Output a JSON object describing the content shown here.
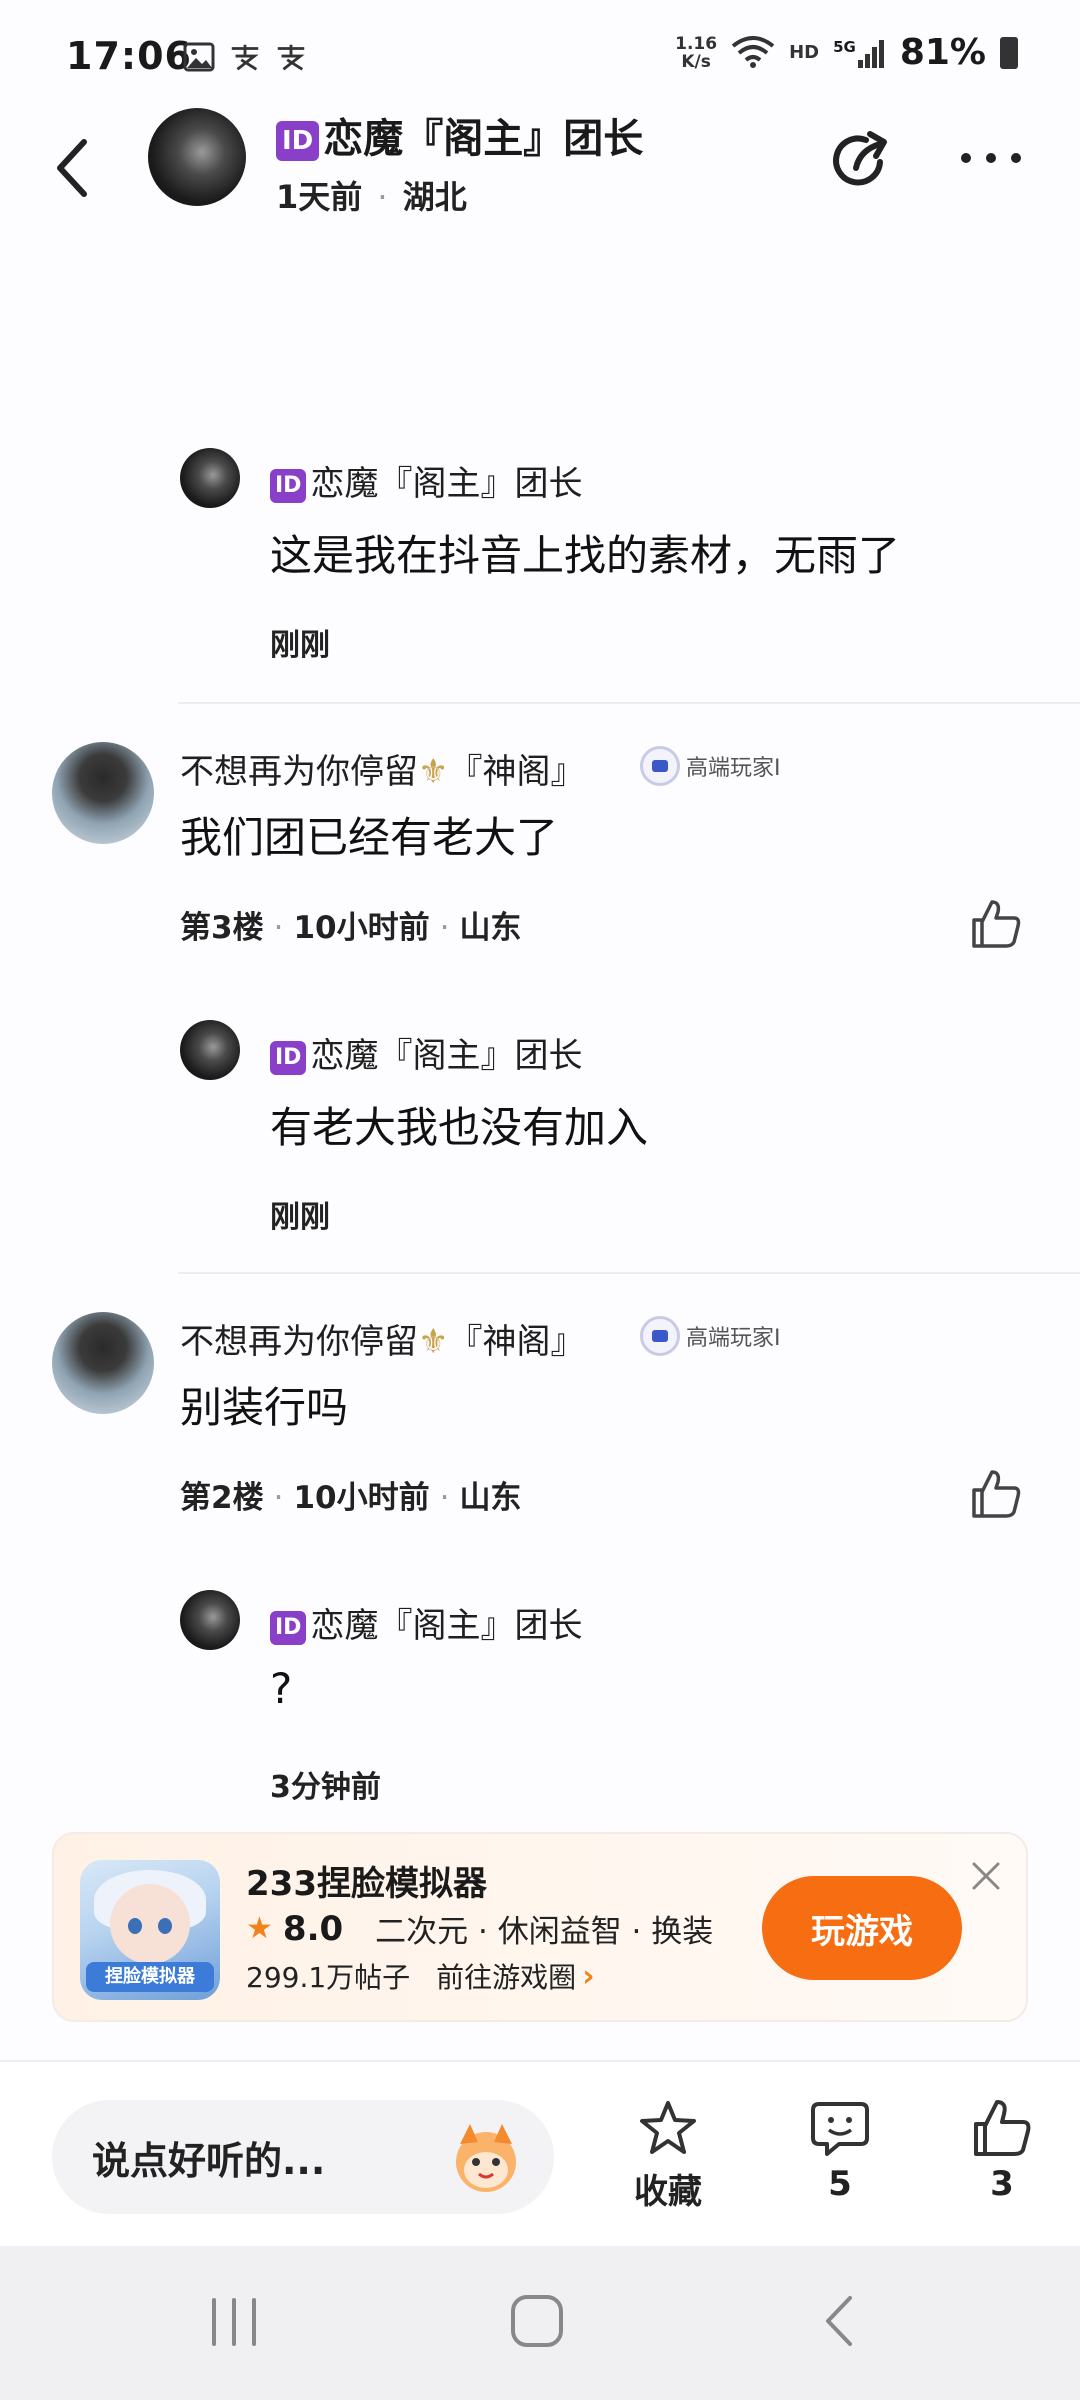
{
  "status_bar": {
    "time": "17:06",
    "net_speed_value": "1.16",
    "net_speed_unit": "K/s",
    "hd": "HD",
    "network": "5G",
    "battery": "81%"
  },
  "header": {
    "badge": "ID",
    "author_name": "恋魔『阁主』团长",
    "meta_time": "1天前",
    "meta_sep": "·",
    "meta_location": "湖北"
  },
  "thread": [
    {
      "type": "reply",
      "badge": "ID",
      "name": "恋魔『阁主』团长",
      "text": "这是我在抖音上找的素材，无雨了",
      "time": "刚刚"
    },
    {
      "type": "comment",
      "name_prefix": "不想再为你停留",
      "name_suffix": "『神阁』",
      "level": "高端玩家I",
      "text": "我们团已经有老大了",
      "floor": "第3楼",
      "time": "10小时前",
      "location": "山东"
    },
    {
      "type": "reply",
      "badge": "ID",
      "name": "恋魔『阁主』团长",
      "text": "有老大我也没有加入",
      "time": "刚刚"
    },
    {
      "type": "comment",
      "name_prefix": "不想再为你停留",
      "name_suffix": "『神阁』",
      "level": "高端玩家I",
      "text": "别装行吗",
      "floor": "第2楼",
      "time": "10小时前",
      "location": "山东"
    },
    {
      "type": "reply",
      "badge": "ID",
      "name": "恋魔『阁主』团长",
      "text": "?",
      "time": "3分钟前"
    }
  ],
  "game_card": {
    "icon_text": "捏脸模拟器",
    "title": "233捏脸模拟器",
    "rating": "8.0",
    "tags": "二次元 · 休闲益智 · 换装",
    "posts": "299.1万帖子",
    "circle_link": "前往游戏圈",
    "play_label": "玩游戏"
  },
  "bottom_bar": {
    "input_placeholder": "说点好听的...",
    "favorite_label": "收藏",
    "comment_count": "5",
    "like_count": "3"
  },
  "colors": {
    "accent_orange": "#f66d12",
    "id_badge_purple": "#8a3fc9"
  }
}
